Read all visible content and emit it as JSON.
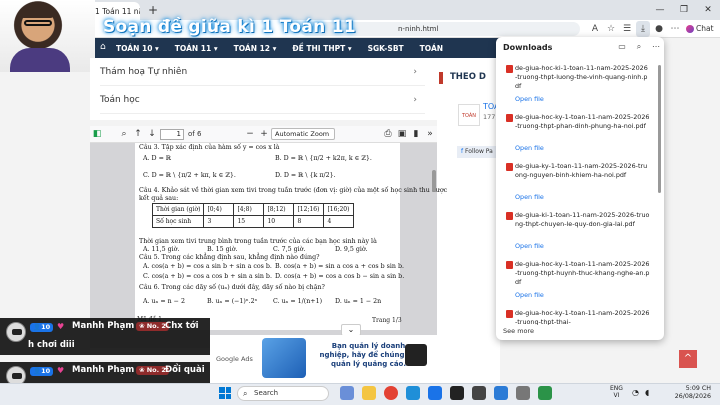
{
  "browser": {
    "tab_title": "Đề giữa học kì 1 Toán 11 năm 20",
    "tab_close": "×",
    "new_tab": "+",
    "url": "n-ninh.html",
    "window_buttons": [
      "—",
      "❐",
      "✕"
    ],
    "chat_label": "Chat"
  },
  "overlay_title": "Soạn đề giữa kì 1 Toán 11",
  "site_nav": {
    "items": [
      "TOÁN 10 ▾",
      "TOÁN 11 ▾",
      "TOÁN 12 ▾",
      "ĐỀ THI THPT ▾",
      "SGK-SBT",
      "TOÁN"
    ]
  },
  "content_list": [
    "Thám hoạ Tự nhiên",
    "Toán học"
  ],
  "right_col": {
    "heading": "THEO D",
    "page_name": "TOÁ",
    "page_count": "177,",
    "follow": "Follow Pa"
  },
  "pdf": {
    "page_current": "1",
    "page_total": "of 6",
    "zoom": "Automatic Zoom",
    "lines": [
      {
        "t": "Câu 3. Tập xác định của hàm số  y = cos x  là",
        "b": "Câu 3."
      },
      {
        "t": "Câu 4. Khảo sát về thời gian xem tivi trong tuần trước (đơn vị: giờ) của một số học sinh thu được",
        "b": "Câu 4."
      },
      {
        "t": "kết quả sau:",
        "b": ""
      },
      {
        "t": "Thời gian xem tivi trung bình trong tuần trước của các bạn học sinh này là",
        "b": ""
      },
      {
        "t": "Câu 5. Trong các khẳng định sau, khẳng định nào đúng?",
        "b": "Câu 5."
      },
      {
        "t": "Câu 6. Trong các dãy số (uₙ) dưới đây, dãy số nào bị chặn?",
        "b": "Câu 6."
      }
    ],
    "q3_opts": [
      "A. D = ℝ",
      "B. D = ℝ \\ {π/2 + k2π, k ∈ ℤ}.",
      "C. D = ℝ \\ {π/2 + kπ, k ∈ ℤ}.",
      "D. D = ℝ \\ {k π/2}."
    ],
    "table": {
      "row1": [
        "Thời gian (giờ)",
        "[0;4)",
        "[4;8)",
        "[8;12)",
        "[12;16)",
        "[16;20)"
      ],
      "row2": [
        "Số học sinh",
        "3",
        "15",
        "10",
        "8",
        "4"
      ]
    },
    "q4_opts": [
      "A. 11,5 giờ.",
      "B. 15 giờ.",
      "C. 7,5 giờ.",
      "D. 9,5 giờ."
    ],
    "q5_opts": [
      "A. cos(a + b) = cos a sin b + sin a cos b.",
      "B. cos(a + b) = sin a cos a + cos b sin b.",
      "C. cos(a + b) = cos a cos b + sin a sin b.",
      "D. cos(a + b) = cos a cos b − sin a sin b."
    ],
    "q6_opts": [
      "A. uₙ = n − 2",
      "B. uₙ = (−1)ⁿ.2ⁿ",
      "C. uₙ = 1/(n+1)",
      "D. uₙ = 1 − 2n"
    ],
    "footer_left": "Mã đề 1",
    "footer_right": "Trang 1/3"
  },
  "ad": {
    "text": "Bạn quản lý doanh nghiệp, hãy để chúng tôi quản lý quảng cáo.",
    "google_ads": "Google Ads"
  },
  "downloads": {
    "title": "Downloads",
    "items": [
      {
        "name": "de-giua-hoc-ki-1-toan-11-nam-2025-2026-truong-thpt-luong-the-vinh-quang-ninh.pdf",
        "open": "Open file"
      },
      {
        "name": "de-giua-hoc-ky-1-toan-11-nam-2025-2026-truong-thpt-phan-dinh-phung-ha-noi.pdf",
        "open": "Open file"
      },
      {
        "name": "de-giua-ky-1-toan-11-nam-2025-2026-truong-nguyen-binh-khiem-ha-noi.pdf",
        "open": "Open file"
      },
      {
        "name": "de-giua-ki-1-toan-11-nam-2025-2026-truong-thpt-chuyen-le-quy-don-gia-lai.pdf",
        "open": "Open file"
      },
      {
        "name": "de-giua-hoc-ky-1-toan-11-nam-2025-2026-truong-thpt-huynh-thuc-khang-nghe-an.pdf",
        "open": "Open file"
      },
      {
        "name": "de-giua-hoc-ky-1-toan-11-nam-2025-2026-truong-thpt-thai-",
        "open": ""
      }
    ],
    "see_more": "See more"
  },
  "chat": [
    {
      "level": "10",
      "user": "Manhh Phạm",
      "rank": "No. 2",
      "msg1": "Chx tới",
      "msg2": "h chơi diii"
    },
    {
      "level": "10",
      "user": "Manhh Phạm",
      "rank": "No. 2",
      "msg1": "Đổi quài",
      "msg2": "đề"
    }
  ],
  "taskbar": {
    "weather_temp": "28°C",
    "weather_desc": "Nhiều mây",
    "search": "Search",
    "lang": "ENG",
    "lang2": "VI",
    "time": "5:09 CH",
    "date": "26/08/2026"
  },
  "colors": {
    "nav": "#1f3550",
    "accent": "#d9534f",
    "link": "#1a73e8"
  }
}
